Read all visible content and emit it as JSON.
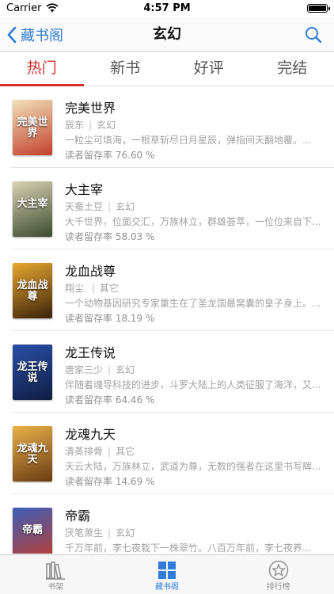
{
  "status_bar": {
    "carrier": "Carrier",
    "time": "4:57 PM"
  },
  "nav": {
    "back_label": "藏书阁",
    "title": "玄幻"
  },
  "tabs": [
    {
      "label": "热门",
      "active": true
    },
    {
      "label": "新书",
      "active": false
    },
    {
      "label": "好评",
      "active": false
    },
    {
      "label": "完结",
      "active": false
    }
  ],
  "books": [
    {
      "title": "完美世界",
      "author": "辰东",
      "category": "玄幻",
      "description": "一粒尘可填海，一根草斩尽日月星辰，弹指间天翻地覆。...",
      "retention": "读者留存率 76.60 %",
      "cover_text": "完美世界",
      "cover_colors": [
        "#f2e0b8",
        "#c2412d"
      ]
    },
    {
      "title": "大主宰",
      "author": "天蚕土豆",
      "category": "玄幻",
      "description": "大千世界，位面交汇，万族林立，群雄荟萃，一位位来自下...",
      "retention": "读者留存率 58.03 %",
      "cover_text": "大主宰",
      "cover_colors": [
        "#d9d2b4",
        "#3c4a2c"
      ]
    },
    {
      "title": "龙血战尊",
      "author": "翔尘.",
      "category": "其它",
      "description": "一个动物基因研究专家重生在了圣龙国最窝囊的皇子身上。...",
      "retention": "读者留存率 18.19 %",
      "cover_text": "龙血战尊",
      "cover_colors": [
        "#e8a830",
        "#3a2208"
      ]
    },
    {
      "title": "龙王传说",
      "author": "唐家三少",
      "category": "玄幻",
      "description": "伴随着魂导科技的进步，斗罗大陆上的人类征服了海洋，又...",
      "retention": "读者留存率 64.46 %",
      "cover_text": "龙王传说",
      "cover_colors": [
        "#2a4fa8",
        "#0f1d42"
      ]
    },
    {
      "title": "龙魂九天",
      "author": "清蒸排骨",
      "category": "其它",
      "description": "天云大陆，万族林立，武道为尊，无数的强者在这里书写辉...",
      "retention": "读者留存率 14.69 %",
      "cover_text": "龙魂九天",
      "cover_colors": [
        "#e9b24a",
        "#6b3b12"
      ]
    },
    {
      "title": "帝霸",
      "author": "厌笔萧生",
      "category": "玄幻",
      "description": "千万年前，李七夜栽下一株翠竹。八百万年前，李七夜养...",
      "retention": "读者留存率 51.34 %",
      "cover_text": "帝霸",
      "cover_colors": [
        "#3d5fb8",
        "#c23a2a"
      ]
    }
  ],
  "tab_bar": [
    {
      "label": "书架",
      "active": false,
      "icon": "bookshelf-icon"
    },
    {
      "label": "藏书阁",
      "active": true,
      "icon": "library-grid-icon"
    },
    {
      "label": "排行榜",
      "active": false,
      "icon": "star-icon"
    }
  ],
  "colors": {
    "accent_blue": "#2f7dd9",
    "accent_red": "#d6302c"
  }
}
